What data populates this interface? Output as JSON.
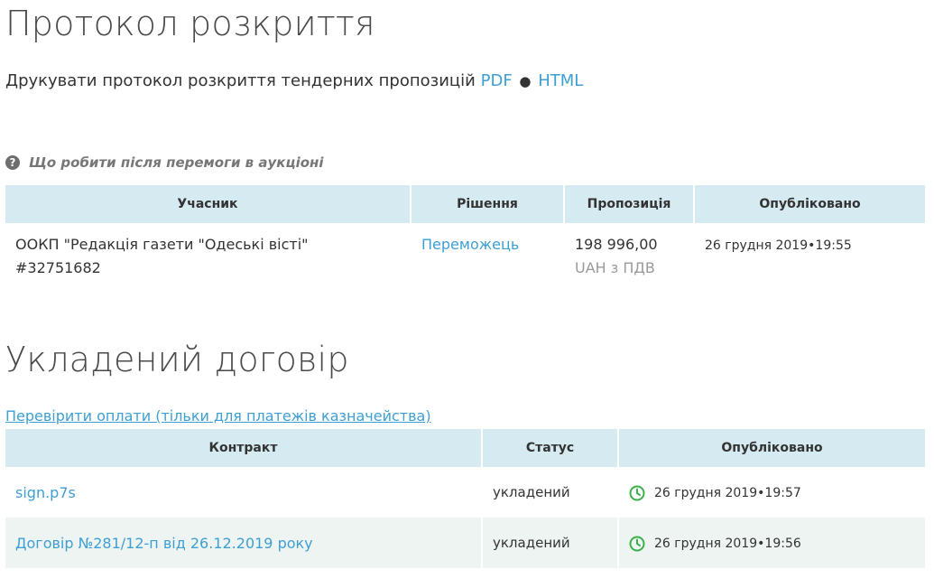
{
  "page": {
    "title": "Протокол розкриття",
    "print_text": "Друкувати протокол розкриття тендерних пропозицій",
    "print_pdf": "PDF",
    "print_dot": "●",
    "print_html": "HTML",
    "help_link": "Що робити після перемоги в аукціоні"
  },
  "bids_table": {
    "headers": [
      "Учасник",
      "Рішення",
      "Пропозиція",
      "Опубліковано"
    ],
    "rows": [
      {
        "participant": "ООКП \"Редакція газети \"Одеські вісті\" #32751682",
        "decision": "Переможець",
        "amount": "198 996,00",
        "currency": "UAH з ПДВ",
        "date": "26 грудня 2019",
        "sep": "•",
        "time": "19:55"
      }
    ]
  },
  "contract": {
    "title": "Укладений договір",
    "verify_link": "Перевірити оплати (тільки для платежів казначейства)",
    "headers": [
      "Контракт",
      "Статус",
      "Опубліковано"
    ],
    "rows": [
      {
        "name": "sign.p7s",
        "status": "укладений",
        "date": "26 грудня 2019",
        "sep": "•",
        "time": "19:57"
      },
      {
        "name": "Договір №281/12-п від 26.12.2019 року",
        "status": "укладений",
        "date": "26 грудня 2019",
        "sep": "•",
        "time": "19:56"
      }
    ]
  },
  "colors": {
    "link": "#3d9fd3",
    "header_bg": "#d6eaf2",
    "row_alt": "#eef4f2",
    "accent_green": "#3cb04a"
  },
  "icons": {
    "help": "question-circle-icon",
    "clock": "clock-icon"
  }
}
